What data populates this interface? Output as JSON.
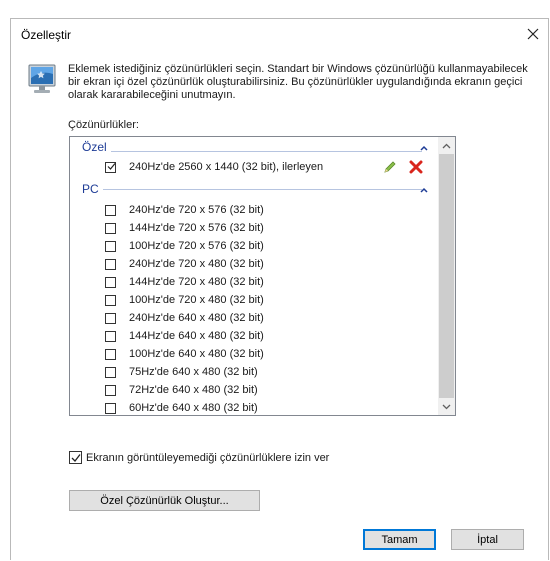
{
  "window": {
    "title": "Özelleştir"
  },
  "description": "Eklemek istediğiniz çözünürlükleri seçin. Standart bir Windows çözünürlüğü kullanmayabilecek bir ekran içi özel çözünürlük oluşturabilirsiniz. Bu çözünürlükler uygulandığında ekranın geçici olarak kararabileceğini unutmayın.",
  "list_label": "Çözünürlükler:",
  "groups": {
    "custom": {
      "name": "Özel",
      "items": [
        {
          "label": "240Hz'de 2560 x 1440 (32 bit), ilerleyen",
          "checked": true
        }
      ]
    },
    "pc": {
      "name": "PC",
      "items": [
        {
          "label": "240Hz'de 720 x 576 (32 bit)",
          "checked": false
        },
        {
          "label": "144Hz'de 720 x 576 (32 bit)",
          "checked": false
        },
        {
          "label": "100Hz'de 720 x 576 (32 bit)",
          "checked": false
        },
        {
          "label": "240Hz'de 720 x 480 (32 bit)",
          "checked": false
        },
        {
          "label": "144Hz'de 720 x 480 (32 bit)",
          "checked": false
        },
        {
          "label": "100Hz'de 720 x 480 (32 bit)",
          "checked": false
        },
        {
          "label": "240Hz'de 640 x 480 (32 bit)",
          "checked": false
        },
        {
          "label": "144Hz'de 640 x 480 (32 bit)",
          "checked": false
        },
        {
          "label": "100Hz'de 640 x 480 (32 bit)",
          "checked": false
        },
        {
          "label": "75Hz'de 640 x 480 (32 bit)",
          "checked": false
        },
        {
          "label": "72Hz'de 640 x 480 (32 bit)",
          "checked": false
        },
        {
          "label": "60Hz'de 640 x 480 (32 bit)",
          "checked": false
        }
      ]
    }
  },
  "allow_unsupported": {
    "label": "Ekranın görüntüleyemediği çözünürlüklere izin ver",
    "checked": true
  },
  "buttons": {
    "create_custom": "Özel Çözünürlük Oluştur...",
    "ok": "Tamam",
    "cancel": "İptal"
  },
  "colors": {
    "group_text": "#1e3c96",
    "default_button_border": "#0078d7",
    "delete_red": "#d9251c",
    "edit_green": "#6fa93a"
  }
}
